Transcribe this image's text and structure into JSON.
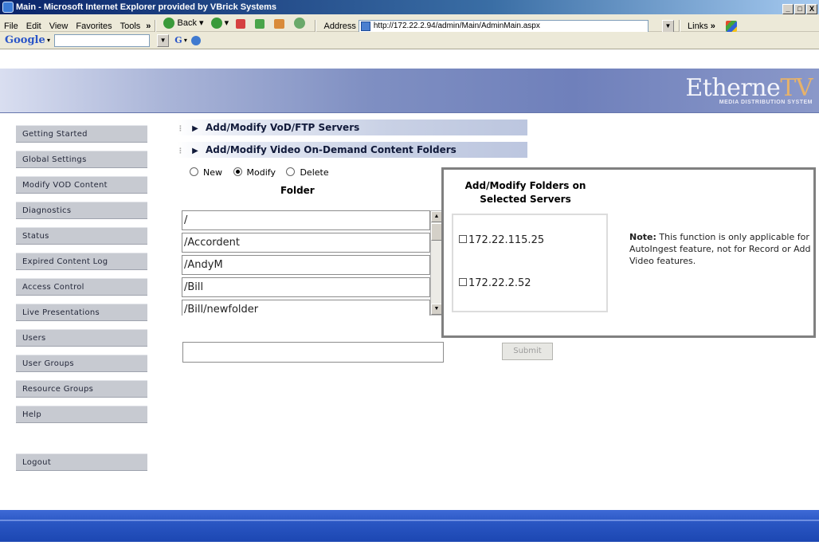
{
  "window": {
    "title": "Main - Microsoft Internet Explorer provided by VBrick Systems",
    "controls": [
      "_",
      "□",
      "X"
    ]
  },
  "menubar": {
    "items": [
      "File",
      "Edit",
      "View",
      "Favorites",
      "Tools"
    ],
    "overflow": "»",
    "back_label": "Back",
    "address_label": "Address",
    "address_url": "http://172.22.2.94/admin/Main/AdminMain.aspx",
    "links_label": "Links",
    "links_overflow": "»"
  },
  "googlebar": {
    "logo": "Google",
    "search_value": "",
    "g_label": "G"
  },
  "banner": {
    "brand_main": "Etherne",
    "brand_tv": "TV",
    "brand_tagline": "MEDIA DISTRIBUTION SYSTEM"
  },
  "sidebar": {
    "items": [
      "Getting Started",
      "Global Settings",
      "Modify VOD Content",
      "Diagnostics",
      "Status",
      "Expired Content Log",
      "Access Control",
      "Live Presentations",
      "Users",
      "User Groups",
      "Resource Groups",
      "Help"
    ],
    "logout": "Logout"
  },
  "content": {
    "section1": "Add/Modify VoD/FTP Servers",
    "section2": "Add/Modify Video On-Demand Content Folders",
    "radio_options": [
      "New",
      "Modify",
      "Delete"
    ],
    "radio_selected": "Modify",
    "folder_header": "Folder",
    "folders": [
      "/",
      "/Accordent",
      "/AndyM",
      "/Bill",
      "/Bill/newfolder"
    ],
    "servers_title_line1": "Add/Modify Folders on",
    "servers_title_line2": "Selected Servers",
    "servers": [
      "172.22.115.25",
      "172.22.2.52"
    ],
    "note_label": "Note:",
    "note_text": "This function is only applicable for AutoIngest feature, not for Record or Add Video features.",
    "new_folder_value": "",
    "submit_label": "Submit"
  },
  "colors": {
    "sidebar_button": "#c7cad1",
    "footer_blue": "#2a56c3",
    "brand_accent": "#e7b26a"
  }
}
